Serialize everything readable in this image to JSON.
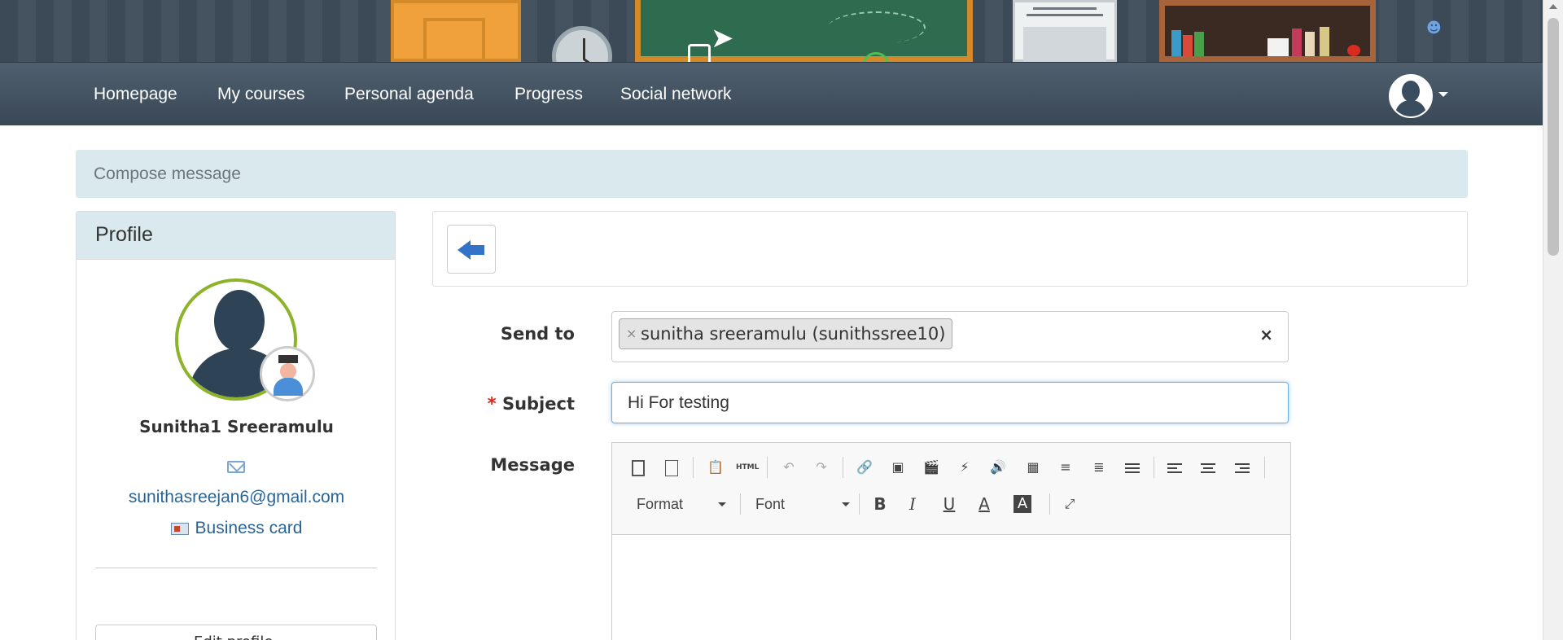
{
  "nav": {
    "items": [
      {
        "label": "Homepage"
      },
      {
        "label": "My courses"
      },
      {
        "label": "Personal agenda"
      },
      {
        "label": "Progress"
      },
      {
        "label": "Social network"
      }
    ]
  },
  "breadcrumb": {
    "title": "Compose message"
  },
  "profile": {
    "heading": "Profile",
    "name": "Sunitha1 Sreeramulu",
    "email": "sunithasreejan6@gmail.com",
    "business_card": "Business card",
    "edit_profile": "Edit profile"
  },
  "form": {
    "send_to_label": "Send to",
    "recipient": "sunitha sreeramulu (sunithssree10)",
    "recipient_remove": "×",
    "clear": "×",
    "required_mark": "*",
    "subject_label": "Subject",
    "subject_value": "Hi For testing",
    "message_label": "Message"
  },
  "editor": {
    "format_label": "Format",
    "font_label": "Font",
    "bold": "B",
    "italic": "I",
    "underline": "U",
    "text_color": "A",
    "bg_color": "A",
    "html_icon": "HTML"
  },
  "colors": {
    "navbar": "#3a4856",
    "breadcrumb_bg": "#d9e9ee",
    "link": "#2a6496",
    "required": "#d9261c",
    "avatar_ring": "#8cb32a"
  }
}
